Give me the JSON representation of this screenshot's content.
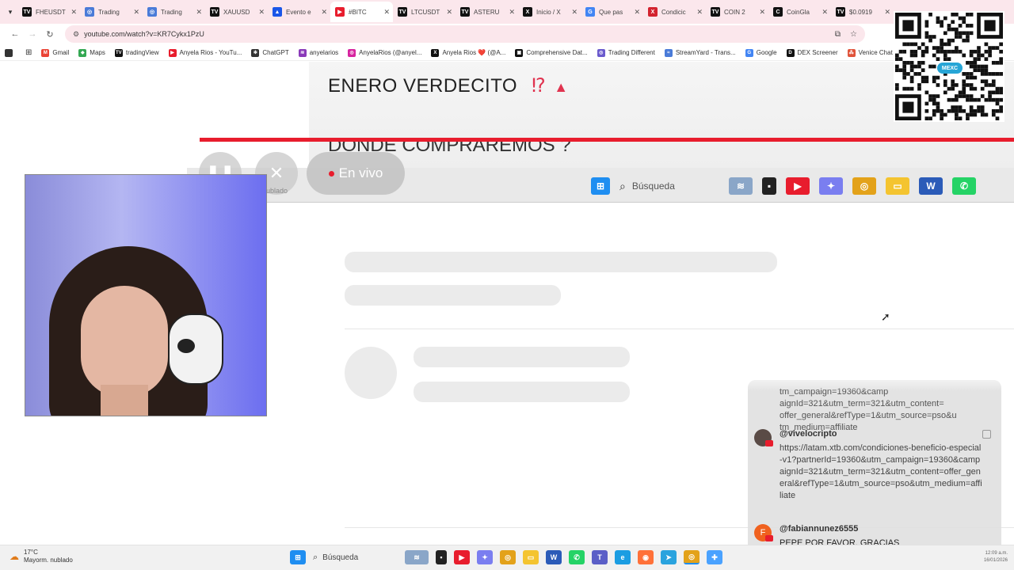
{
  "browser": {
    "tabs": [
      {
        "label": "FHEUSDT",
        "color": "#111111",
        "glyph": "TV",
        "active": false
      },
      {
        "label": "Trading",
        "color": "#4a7bd8",
        "glyph": "◎",
        "active": false
      },
      {
        "label": "Trading",
        "color": "#4a7bd8",
        "glyph": "◎",
        "active": false
      },
      {
        "label": "XAUUSD",
        "color": "#111111",
        "glyph": "TV",
        "active": false
      },
      {
        "label": "Evento e",
        "color": "#1a56e8",
        "glyph": "▲",
        "active": false
      },
      {
        "label": "#BITC",
        "color": "#e81d2d",
        "glyph": "▶",
        "active": true
      },
      {
        "label": "LTCUSDT",
        "color": "#111111",
        "glyph": "TV",
        "active": false
      },
      {
        "label": "ASTERU",
        "color": "#111111",
        "glyph": "TV",
        "active": false
      },
      {
        "label": "Inicio / X",
        "color": "#111111",
        "glyph": "X",
        "active": false
      },
      {
        "label": "Que pas",
        "color": "#4285f4",
        "glyph": "G",
        "active": false
      },
      {
        "label": "Condicic",
        "color": "#d3232f",
        "glyph": "X",
        "active": false
      },
      {
        "label": "COIN 2",
        "color": "#111111",
        "glyph": "TV",
        "active": false
      },
      {
        "label": "CoinGla",
        "color": "#111111",
        "glyph": "C",
        "active": false
      },
      {
        "label": "$0.0919",
        "color": "#111111",
        "glyph": "TV",
        "active": false
      }
    ],
    "url": "youtube.com/watch?v=KR7Cykx1PzU",
    "bookmarks": [
      {
        "label": "Gmail",
        "color": "#ea4335",
        "glyph": "M"
      },
      {
        "label": "Maps",
        "color": "#34a853",
        "glyph": "◆"
      },
      {
        "label": "tradingView",
        "color": "#111111",
        "glyph": "TV"
      },
      {
        "label": "Anyela Rios - YouTu...",
        "color": "#e81d2d",
        "glyph": "▶"
      },
      {
        "label": "ChatGPT",
        "color": "#333333",
        "glyph": "✻"
      },
      {
        "label": "anyelarios",
        "color": "#8a3ab9",
        "glyph": "≋"
      },
      {
        "label": "AnyelaRios (@anyel...",
        "color": "#d6249f",
        "glyph": "◎"
      },
      {
        "label": "Anyela Rios ❤️ (@A...",
        "color": "#111111",
        "glyph": "X"
      },
      {
        "label": "Comprehensive Dat...",
        "color": "#111111",
        "glyph": "▣"
      },
      {
        "label": "Trading Different",
        "color": "#6a5acd",
        "glyph": "◎"
      },
      {
        "label": "StreamYard - Trans...",
        "color": "#4a7bd8",
        "glyph": "≈"
      },
      {
        "label": "Google",
        "color": "#4285f4",
        "glyph": "G"
      },
      {
        "label": "DEX Screener",
        "color": "#111111",
        "glyph": "D"
      },
      {
        "label": "Venice Chat - Ve",
        "color": "#e0533a",
        "glyph": "⁂"
      }
    ]
  },
  "slide": {
    "title": "ENERO VERDECITO",
    "title_marks": "⁉",
    "subtitle": "DONDE COMPRAREMOS ?"
  },
  "player": {
    "live_label": "En vivo",
    "caption": "ublado"
  },
  "screen_taskbar": {
    "search_label": "Búsqueda"
  },
  "qr": {
    "badge": "MEXC"
  },
  "chat": {
    "previous_text": "tm_campaign=19360&camp aignId=321&utm_term=321&utm_content= offer_general&refType=1&utm_source=pso&u tm_medium=affiliate",
    "messages": [
      {
        "user": "@vivelocripto",
        "text": "https://latam.xtb.com/condiciones-beneficio-especial-v1?partnerId=19360&utm_campaign=19360&campaignId=321&utm_term=321&utm_content=offer_general&refType=1&utm_source=pso&utm_medium=affiliate"
      },
      {
        "user": "@fabiannunez6555",
        "avatar_letter": "F",
        "text": "PEPE POR FAVOR. GRACIAS"
      }
    ]
  },
  "os": {
    "temperature": "17°C",
    "weather": "Mayorm. nublado",
    "search_label": "Búsqueda",
    "time": "12:09 a.m.",
    "date": "16/01/2026"
  }
}
